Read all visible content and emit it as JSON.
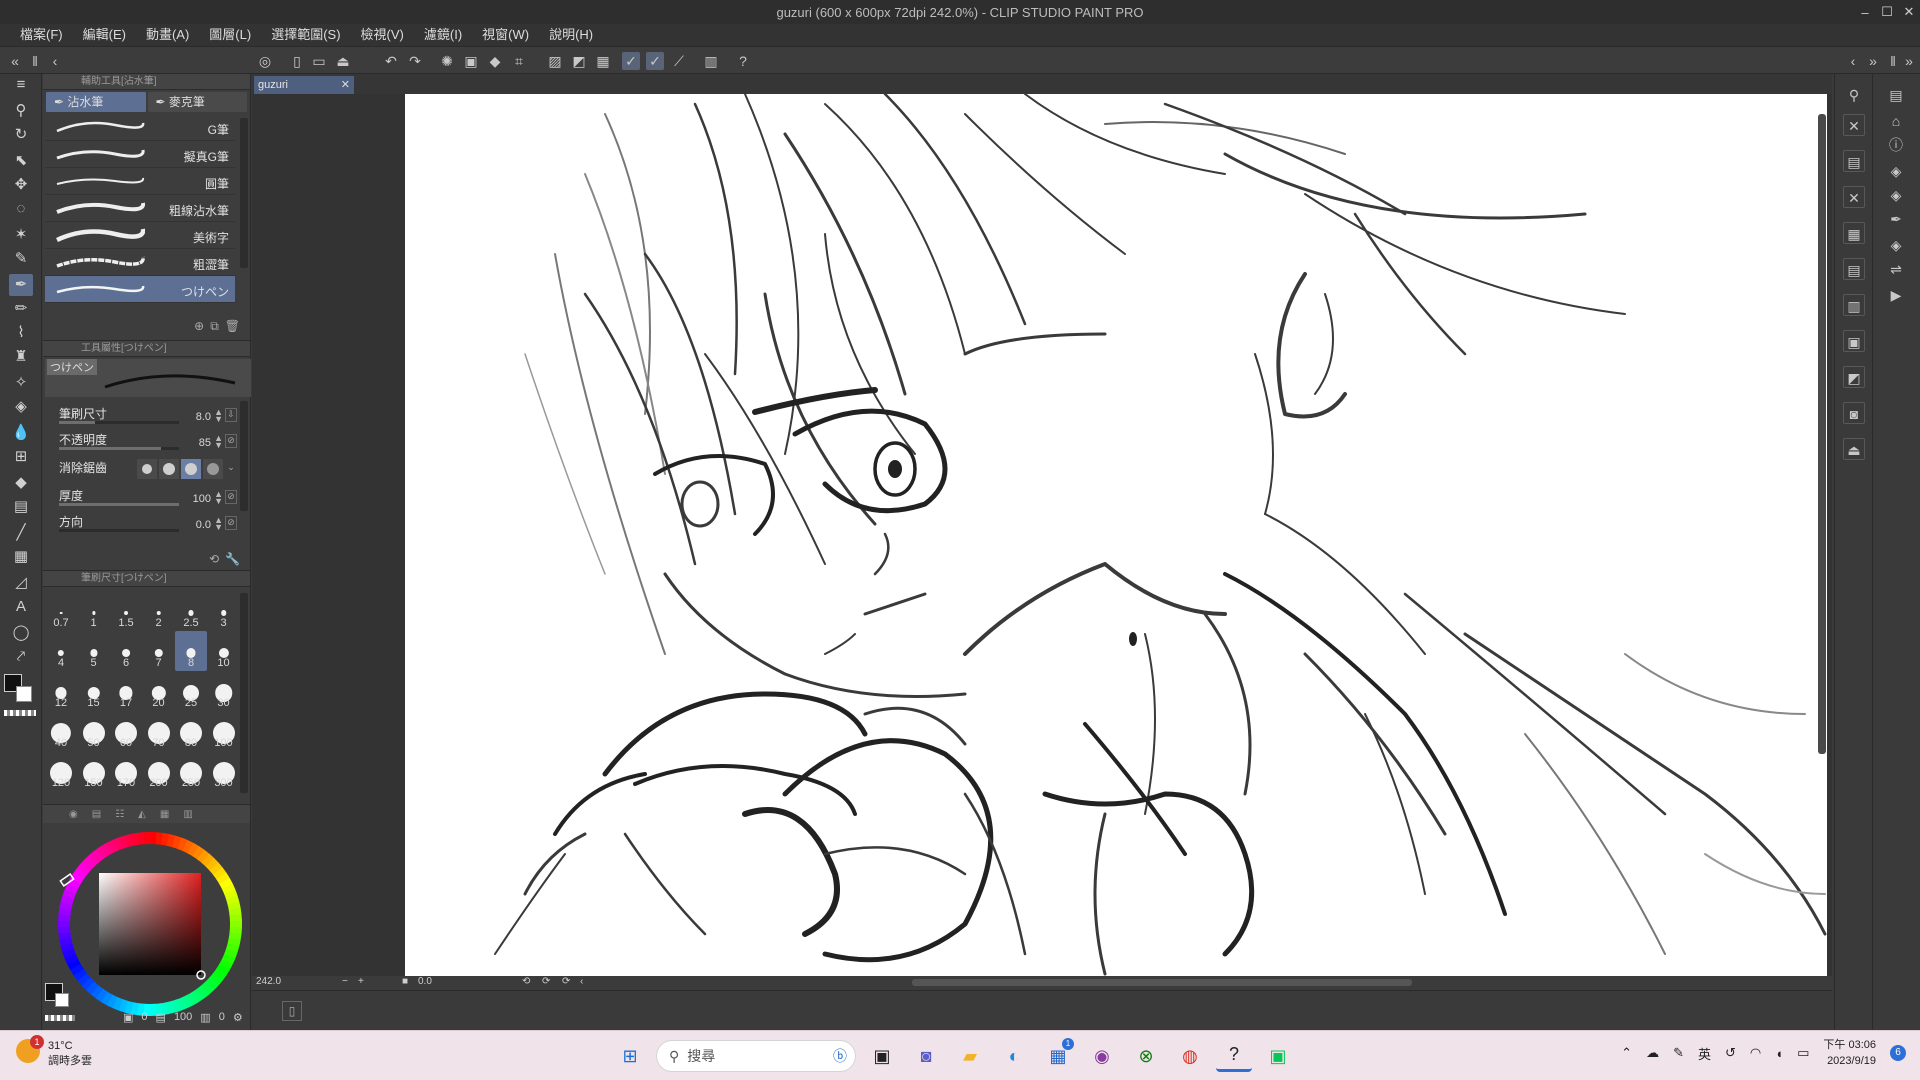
{
  "window": {
    "title": "guzuri (600 x 600px 72dpi 242.0%)  - CLIP STUDIO PAINT PRO",
    "minimize_icon": "minimize-icon",
    "maximize_icon": "maximize-icon",
    "close_icon": "close-icon"
  },
  "menu": {
    "items": [
      "檔案(F)",
      "編輯(E)",
      "動畫(A)",
      "圖層(L)",
      "選擇範圍(S)",
      "檢視(V)",
      "濾鏡(I)",
      "視窗(W)",
      "說明(H)"
    ]
  },
  "subtool_panel": {
    "header": "輔助工具[沾水筆]",
    "groups": [
      "沾水筆",
      "麥克筆"
    ],
    "active_group": "沾水筆",
    "brushes": [
      "G筆",
      "擬真G筆",
      "圓筆",
      "粗線沾水筆",
      "美術字",
      "粗澀筆",
      "つけペン"
    ],
    "active_brush": "つけペン"
  },
  "tool_property": {
    "header": "工具屬性[つけペン]",
    "preview_label": "つけペン",
    "brush_size_label": "筆刷尺寸",
    "brush_size_value": "8.0",
    "opacity_label": "不透明度",
    "opacity_value": "85",
    "antialias_label": "消除鋸齒",
    "thickness_label": "厚度",
    "thickness_value": "100",
    "direction_label": "方向",
    "direction_value": "0.0"
  },
  "brush_size_panel": {
    "header": "筆刷尺寸[つけペン]",
    "sizes": [
      "0.7",
      "1",
      "1.5",
      "2",
      "2.5",
      "3",
      "4",
      "5",
      "6",
      "7",
      "8",
      "10",
      "12",
      "15",
      "17",
      "20",
      "25",
      "30",
      "40",
      "50",
      "60",
      "70",
      "80",
      "100",
      "120",
      "150",
      "170",
      "200",
      "250",
      "300"
    ],
    "selected": "8"
  },
  "color_panel": {
    "value_a": "0",
    "value_b": "100",
    "value_c": "0"
  },
  "document": {
    "tab_name": "guzuri"
  },
  "status": {
    "zoom": "242.0",
    "angle": "0.0"
  },
  "taskbar": {
    "weather_temp": "31°C",
    "weather_desc": "調時多雲",
    "weather_badge": "1",
    "search_placeholder": "搜尋",
    "store_badge": "1",
    "ime_label": "英",
    "time": "下午 03:06",
    "date": "2023/9/19",
    "notification_count": "6"
  },
  "colors": {
    "accent": "#5d6f93",
    "panel_bg": "#3d3d3d",
    "taskbar_bg": "#f0e4ea"
  }
}
